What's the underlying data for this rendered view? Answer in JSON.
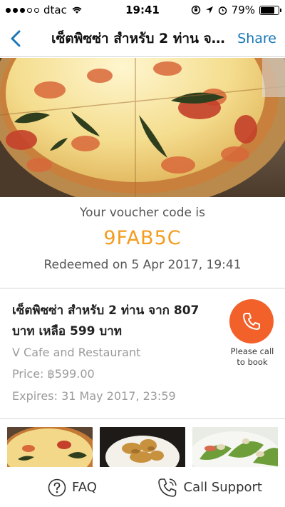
{
  "status_bar": {
    "carrier": "dtac",
    "time": "19:41",
    "battery": "79%",
    "battery_level": 0.79
  },
  "nav": {
    "title": "เซ็ตพิซซ่า สำหรับ 2 ท่าน จาก 807 บาท เหลือ 599 บาท",
    "share_label": "Share",
    "tint": "#1a78b8"
  },
  "voucher": {
    "label": "Your voucher code is",
    "code": "9FAB5C",
    "code_color": "#f39c1e",
    "redeemed": "Redeemed on 5 Apr 2017, 19:41"
  },
  "deal": {
    "title": "เซ็ตพิซซ่า สำหรับ 2 ท่าน จาก 807 บาท เหลือ 599 บาท",
    "venue": "V Cafe and Restaurant",
    "price": "Price: ฿599.00",
    "expires": "Expires: 31 May 2017, 23:59"
  },
  "call": {
    "line1": "Please call",
    "line2": "to book",
    "color": "#f3612b"
  },
  "bottom_bar": {
    "faq_label": "FAQ",
    "support_label": "Call Support"
  }
}
